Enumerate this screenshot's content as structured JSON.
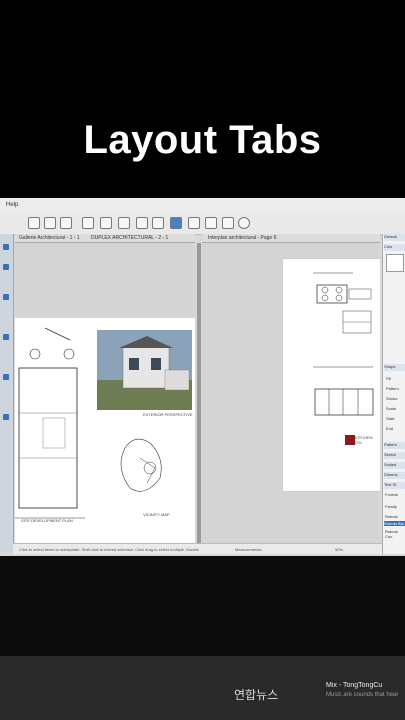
{
  "title": "Layout Tabs",
  "menu": {
    "help": "Help"
  },
  "tabs": {
    "left_a": "Gallerie Architectural - 1 - 1",
    "left_b": "DUPLEX ARCHITECTURAL - 2 - 1",
    "right": "Interplan architectural - Page 6"
  },
  "right_panel": {
    "default_tray": "Default",
    "sections": [
      "Colo",
      "Shape",
      "Pattern",
      "Sketch",
      "Scaled",
      "Dimens",
      "Text St"
    ],
    "fields": [
      "Fill",
      "Pattern",
      "Stroke",
      "Scale",
      "Start",
      "End"
    ],
    "text_rows": [
      "Format",
      "Family",
      "Roboto",
      "Roboto Bla",
      "Roboto Con"
    ]
  },
  "sheet_labels": {
    "cad_site": "SITE DEVELOPMENT PLAN",
    "exterior": "EXTERIOR PERSPECTIVE",
    "vicinity": "VICINITY MAP",
    "kitchen": "KITCHEN DTL"
  },
  "status": {
    "hint": "Click to select items to manipulate. Shift click to extend selection. Click drag to select multiple. Double",
    "measure": "Measurements",
    "zoom": "50%"
  },
  "watermark": "연합뉴스",
  "music": {
    "title": "Mix - TongTongCu",
    "subtitle": "Music are sounds that hear"
  }
}
